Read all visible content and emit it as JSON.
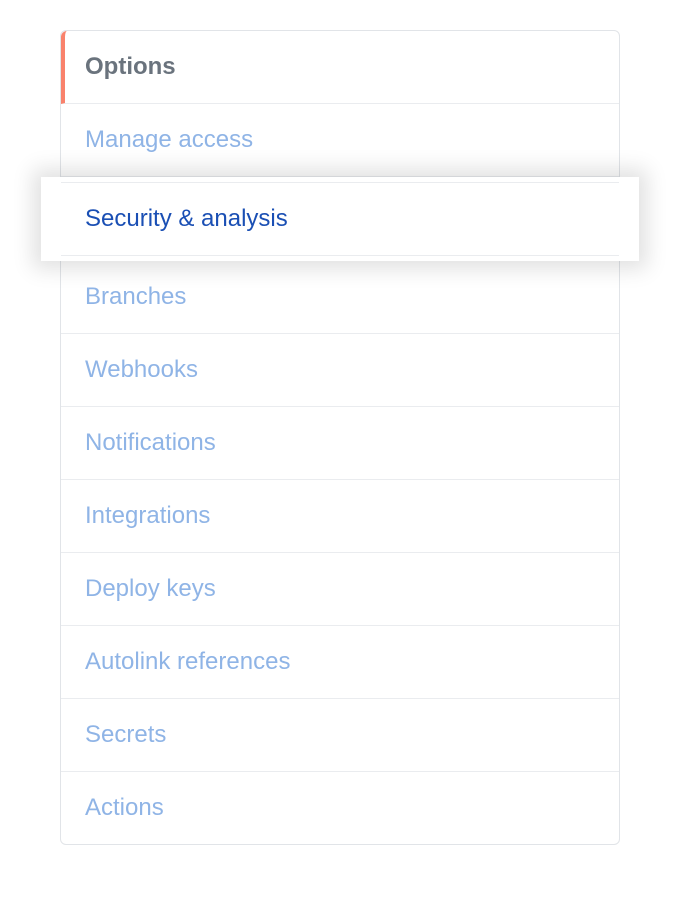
{
  "sidebar": {
    "items": [
      {
        "label": "Options"
      },
      {
        "label": "Manage access"
      },
      {
        "label": "Security & analysis"
      },
      {
        "label": "Branches"
      },
      {
        "label": "Webhooks"
      },
      {
        "label": "Notifications"
      },
      {
        "label": "Integrations"
      },
      {
        "label": "Deploy keys"
      },
      {
        "label": "Autolink references"
      },
      {
        "label": "Secrets"
      },
      {
        "label": "Actions"
      }
    ]
  }
}
